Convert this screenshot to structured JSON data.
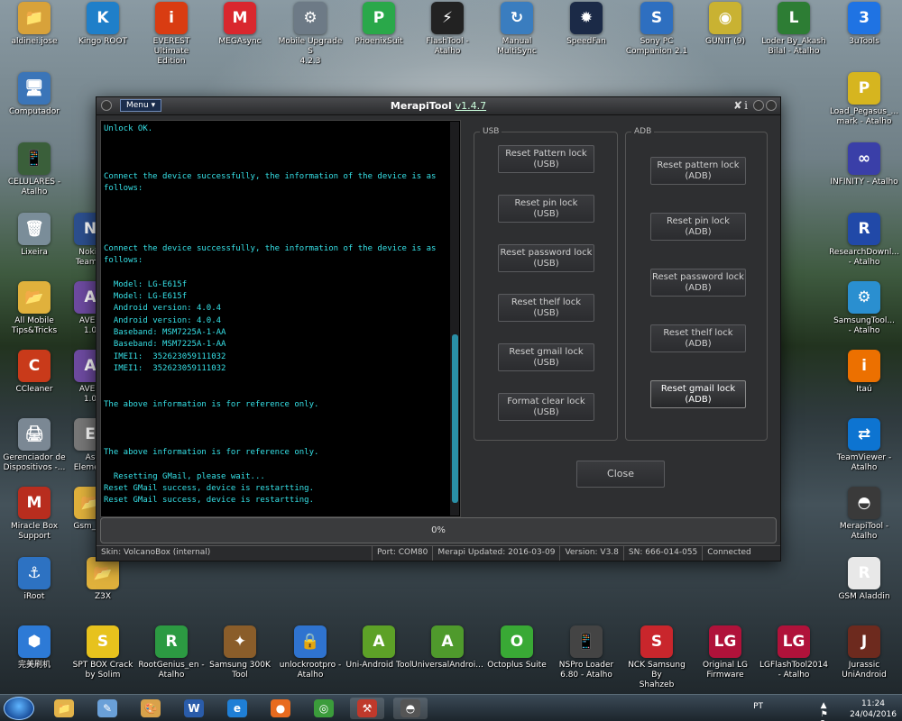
{
  "desktop_icons": [
    {
      "label": "aldinei.jose",
      "icon": "folder-user-icon",
      "color": "#d8a23a",
      "glyph": "📁"
    },
    {
      "label": "Kingo ROOT",
      "icon": "kingo-root-icon",
      "color": "#1f7fc9",
      "glyph": "K"
    },
    {
      "label": "EVEREST Ultimate\nEdition",
      "icon": "everest-icon",
      "color": "#d93c12",
      "glyph": "i"
    },
    {
      "label": "MEGAsync",
      "icon": "megasync-icon",
      "color": "#d9272e",
      "glyph": "M"
    },
    {
      "label": "Mobile Upgrade S\n4.2.3",
      "icon": "gear-icon",
      "color": "#6d7a86",
      "glyph": "⚙"
    },
    {
      "label": "PhoenixSuit",
      "icon": "phoenixsuit-icon",
      "color": "#2aa84a",
      "glyph": "P"
    },
    {
      "label": "FlashTool -\nAtalho",
      "icon": "flashtool-icon",
      "color": "#222222",
      "glyph": "⚡"
    },
    {
      "label": "Manual\nMultiSync",
      "icon": "sync-icon",
      "color": "#3a7dbf",
      "glyph": "↻"
    },
    {
      "label": "SpeedFan",
      "icon": "speedfan-icon",
      "color": "#1b2a47",
      "glyph": "✹"
    },
    {
      "label": "Sony PC\nCompanion 2.1",
      "icon": "sony-pc-companion-icon",
      "color": "#2e6fc0",
      "glyph": "S"
    },
    {
      "label": "GUNIT (9)",
      "icon": "disc-icon",
      "color": "#c9b232",
      "glyph": "◉"
    },
    {
      "label": "Loder By_Akash\nBilal - Atalho",
      "icon": "loader-icon",
      "color": "#2d7d34",
      "glyph": "L"
    },
    {
      "label": "3uTools",
      "icon": "3utools-icon",
      "color": "#1f73e3",
      "glyph": "3"
    },
    {
      "label": "Computador",
      "icon": "computer-icon",
      "color": "#3b75b8",
      "glyph": "🖥"
    },
    {
      "label": "Load_Pegasus_...\nmark - Atalho",
      "icon": "pegasus-icon",
      "color": "#d6b51f",
      "glyph": "P"
    },
    {
      "label": "CELULARES -\nAtalho",
      "icon": "phone-folder-icon",
      "color": "#3a5f3a",
      "glyph": "📱"
    },
    {
      "label": "INFINITY - Atalho",
      "icon": "infinity-icon",
      "color": "#3a3fa8",
      "glyph": "∞"
    },
    {
      "label": "Lixeira",
      "icon": "recycle-bin-icon",
      "color": "#7a8d99",
      "glyph": "🗑"
    },
    {
      "label": "ResearchDownl...\n- Atalho",
      "icon": "research-download-icon",
      "color": "#2149a8",
      "glyph": "R"
    },
    {
      "label": "All Mobile\nTips&Tricks",
      "icon": "folder-icon",
      "color": "#e0b13c",
      "glyph": "📂"
    },
    {
      "label": "SamsungTool...\n- Atalho",
      "icon": "samsung-tool-icon",
      "color": "#2a8fd0",
      "glyph": "⚙"
    },
    {
      "label": "CCleaner",
      "icon": "ccleaner-icon",
      "color": "#c93a1a",
      "glyph": "C"
    },
    {
      "label": "Itaú",
      "icon": "itau-icon",
      "color": "#ec7000",
      "glyph": "i"
    },
    {
      "label": "Gerenciador de\nDispositivos -...",
      "icon": "device-manager-icon",
      "color": "#7b8894",
      "glyph": "🖨"
    },
    {
      "label": "TeamViewer -\nAtalho",
      "icon": "teamviewer-icon",
      "color": "#0d74d1",
      "glyph": "⇄"
    },
    {
      "label": "Miracle Box\nSupport",
      "icon": "miracle-box-icon",
      "color": "#b82d1e",
      "glyph": "M"
    },
    {
      "label": "MerapiTool -\nAtalho",
      "icon": "merapitool-icon",
      "color": "#3a3a3a",
      "glyph": "◓"
    },
    {
      "label": "iRoot",
      "icon": "iroot-icon",
      "color": "#2d72c2",
      "glyph": "⚓"
    },
    {
      "label": "Z3X",
      "icon": "folder-icon",
      "color": "#e0b13c",
      "glyph": "📂"
    },
    {
      "label": "GSM Aladdin",
      "icon": "gsm-aladdin-icon",
      "color": "#e8e8e8",
      "glyph": "R"
    },
    {
      "label": "完美刷机",
      "icon": "android-flash-icon",
      "color": "#2d7ad6",
      "glyph": "⬢"
    },
    {
      "label": "SPT BOX Crack\nby Solim",
      "icon": "spt-box-icon",
      "color": "#e7c21d",
      "glyph": "S"
    },
    {
      "label": "RootGenius_en -\nAtalho",
      "icon": "rootgenius-icon",
      "color": "#2c9a42",
      "glyph": "R"
    },
    {
      "label": "Samsung 300K\nTool",
      "icon": "samsung-300k-icon",
      "color": "#8a5d2a",
      "glyph": "✦"
    },
    {
      "label": "unlockrootpro -\nAtalho",
      "icon": "unlockroot-icon",
      "color": "#2f73cf",
      "glyph": "🔒"
    },
    {
      "label": "Uni-Android Tool",
      "icon": "android-icon",
      "color": "#5da127",
      "glyph": "A"
    },
    {
      "label": "UniversalAndroi...",
      "icon": "android-icon",
      "color": "#4f9a2c",
      "glyph": "A"
    },
    {
      "label": "Octoplus Suite",
      "icon": "octoplus-icon",
      "color": "#39a935",
      "glyph": "O"
    },
    {
      "label": "NSPro Loader\n6.80 - Atalho",
      "icon": "nspro-icon",
      "color": "#444444",
      "glyph": "📱"
    },
    {
      "label": "NCK Samsung By\nShahzeb",
      "icon": "nck-icon",
      "color": "#c9262c",
      "glyph": "S"
    },
    {
      "label": "Original LG\nFirmware",
      "icon": "lg-icon",
      "color": "#b0123a",
      "glyph": "LG"
    },
    {
      "label": "LGFlashTool2014\n- Atalho",
      "icon": "lg-icon",
      "color": "#b0123a",
      "glyph": "LG"
    },
    {
      "label": "Jurassic\nUniAndroid",
      "icon": "jurassic-icon",
      "color": "#6d2a1e",
      "glyph": "J"
    },
    {
      "label": "Nokia\nTeam...",
      "icon": "nokia-icon",
      "color": "#2c4f8e",
      "glyph": "N"
    },
    {
      "label": "AVEN\n1.0",
      "icon": "aven-icon",
      "color": "#6d4aa0",
      "glyph": "A"
    },
    {
      "label": "AVEN\n1.0",
      "icon": "aven-icon",
      "color": "#6d4aa0",
      "glyph": "A"
    },
    {
      "label": "As\nEleme...",
      "icon": "elements-icon",
      "color": "#777777",
      "glyph": "E"
    },
    {
      "label": "Gsm_F...",
      "icon": "folder-icon",
      "color": "#e0b13c",
      "glyph": "📂"
    }
  ],
  "window": {
    "menu_label": "Menu ▾",
    "title": "MerapiTool",
    "version": "v1.4.7",
    "pin_glyph": "✘",
    "info_glyph": "i"
  },
  "console": {
    "lines": [
      "Unlock OK.",
      "",
      "",
      "",
      "Connect the device successfully, the information of the device is as follows:",
      "",
      "",
      "",
      "",
      "Connect the device successfully, the information of the device is as follows:",
      "",
      "  Model: LG-E615f",
      "  Model: LG-E615f",
      "  Android version: 4.0.4",
      "  Android version: 4.0.4",
      "  Baseband: MSM7225A-1-AA",
      "  Baseband: MSM7225A-1-AA",
      "  IMEI1:  352623059111032",
      "  IMEI1:  352623059111032",
      "",
      "",
      "The above information is for reference only.",
      "",
      "",
      "",
      "The above information is for reference only.",
      "",
      "  Resetting GMail, please wait...",
      "Reset GMail success, device is restartting.",
      "Reset GMail success, device is restartting."
    ]
  },
  "usb_group": {
    "title": "USB",
    "buttons": [
      {
        "line1": "Reset Pattern lock",
        "line2": "(USB)"
      },
      {
        "line1": "Reset pin lock",
        "line2": "(USB)"
      },
      {
        "line1": "Reset password lock",
        "line2": "(USB)"
      },
      {
        "line1": "Reset thelf lock",
        "line2": "(USB)"
      },
      {
        "line1": "Reset gmail lock",
        "line2": "(USB)"
      },
      {
        "line1": "Format clear lock",
        "line2": "(USB)"
      }
    ]
  },
  "adb_group": {
    "title": "ADB",
    "buttons": [
      {
        "line1": "Reset pattern lock",
        "line2": "(ADB)"
      },
      {
        "line1": "Reset pin lock",
        "line2": "(ADB)"
      },
      {
        "line1": "Reset password lock",
        "line2": "(ADB)"
      },
      {
        "line1": "Reset thelf lock",
        "line2": "(ADB)"
      },
      {
        "line1": "Reset gmail lock",
        "line2": "(ADB)"
      }
    ]
  },
  "close_label": "Close",
  "progress": {
    "text": "0%",
    "value": 0
  },
  "status": {
    "skin": "Skin: VolcanoBox (internal)",
    "port": "Port: COM80",
    "updated": "Merapi Updated: 2016-03-09",
    "version": "Version: V3.8",
    "sn": "SN: 666-014-055",
    "state": "Connected"
  },
  "taskbar": {
    "apps": [
      {
        "icon": "file-explorer-icon",
        "color": "#e3b34a",
        "glyph": "📁"
      },
      {
        "icon": "notepad-icon",
        "color": "#6aa0d8",
        "glyph": "✎"
      },
      {
        "icon": "paint-icon",
        "color": "#d9a24a",
        "glyph": "🎨"
      },
      {
        "icon": "word-icon",
        "color": "#2a5caa",
        "glyph": "W"
      },
      {
        "icon": "internet-explorer-icon",
        "color": "#1f7fd6",
        "glyph": "e"
      },
      {
        "icon": "firefox-icon",
        "color": "#e86b1f",
        "glyph": "●"
      },
      {
        "icon": "chrome-icon",
        "color": "#3b9c3b",
        "glyph": "◎"
      },
      {
        "icon": "toolbox-icon",
        "color": "#c0392b",
        "glyph": "⚒"
      },
      {
        "icon": "merapitool-icon",
        "color": "#555555",
        "glyph": "◓"
      }
    ],
    "lang": "PT",
    "time": "11:24",
    "date": "24/04/2016"
  }
}
